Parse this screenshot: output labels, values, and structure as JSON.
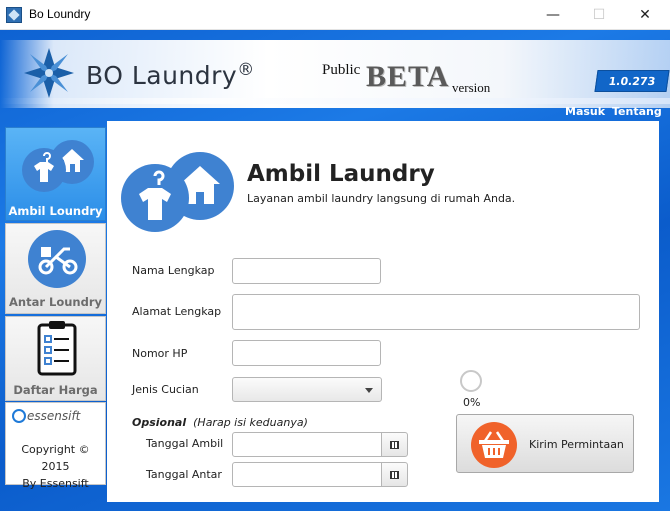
{
  "window": {
    "title": "Bo Loundry",
    "minimize_glyph": "—",
    "maximize_glyph": "☐",
    "close_glyph": "✕"
  },
  "banner": {
    "brand": "BO Laundry",
    "reg_mark": "®",
    "public": "Public",
    "beta": "BETA",
    "version_word": "version",
    "version_number": "1.0.273"
  },
  "toplinks": {
    "masuk": "Masuk",
    "tentang": "Tentang"
  },
  "sidebar": {
    "items": [
      {
        "label": "Ambil Loundry",
        "icon": "laundry-pickup-icon",
        "active": true
      },
      {
        "label": "Antar Loundry",
        "icon": "delivery-bike-icon",
        "active": false
      },
      {
        "label": "Daftar Harga",
        "icon": "price-list-icon",
        "active": false
      }
    ],
    "company_logo": "essensift",
    "copyright": "Copyright © 2015",
    "by": "By Essensift"
  },
  "main": {
    "title": "Ambil Laundry",
    "subtitle": "Layanan ambil laundry langsung di rumah Anda.",
    "fields": {
      "nama_label": "Nama Lengkap",
      "nama_value": "",
      "alamat_label": "Alamat Lengkap",
      "alamat_value": "",
      "hp_label": "Nomor HP",
      "hp_value": "",
      "jenis_label": "Jenis Cucian",
      "jenis_value": ""
    },
    "optional": {
      "title": "Opsional",
      "hint": "(Harap isi keduanya)",
      "ambil_label": "Tanggal Ambil",
      "ambil_value": "",
      "antar_label": "Tanggal Antar",
      "antar_value": ""
    },
    "progress": "0%",
    "submit_label": "Kirim Permintaan"
  },
  "colors": {
    "accent_blue": "#1f7ad8",
    "icon_blue": "#3f82d1",
    "basket_orange": "#f0622a"
  }
}
